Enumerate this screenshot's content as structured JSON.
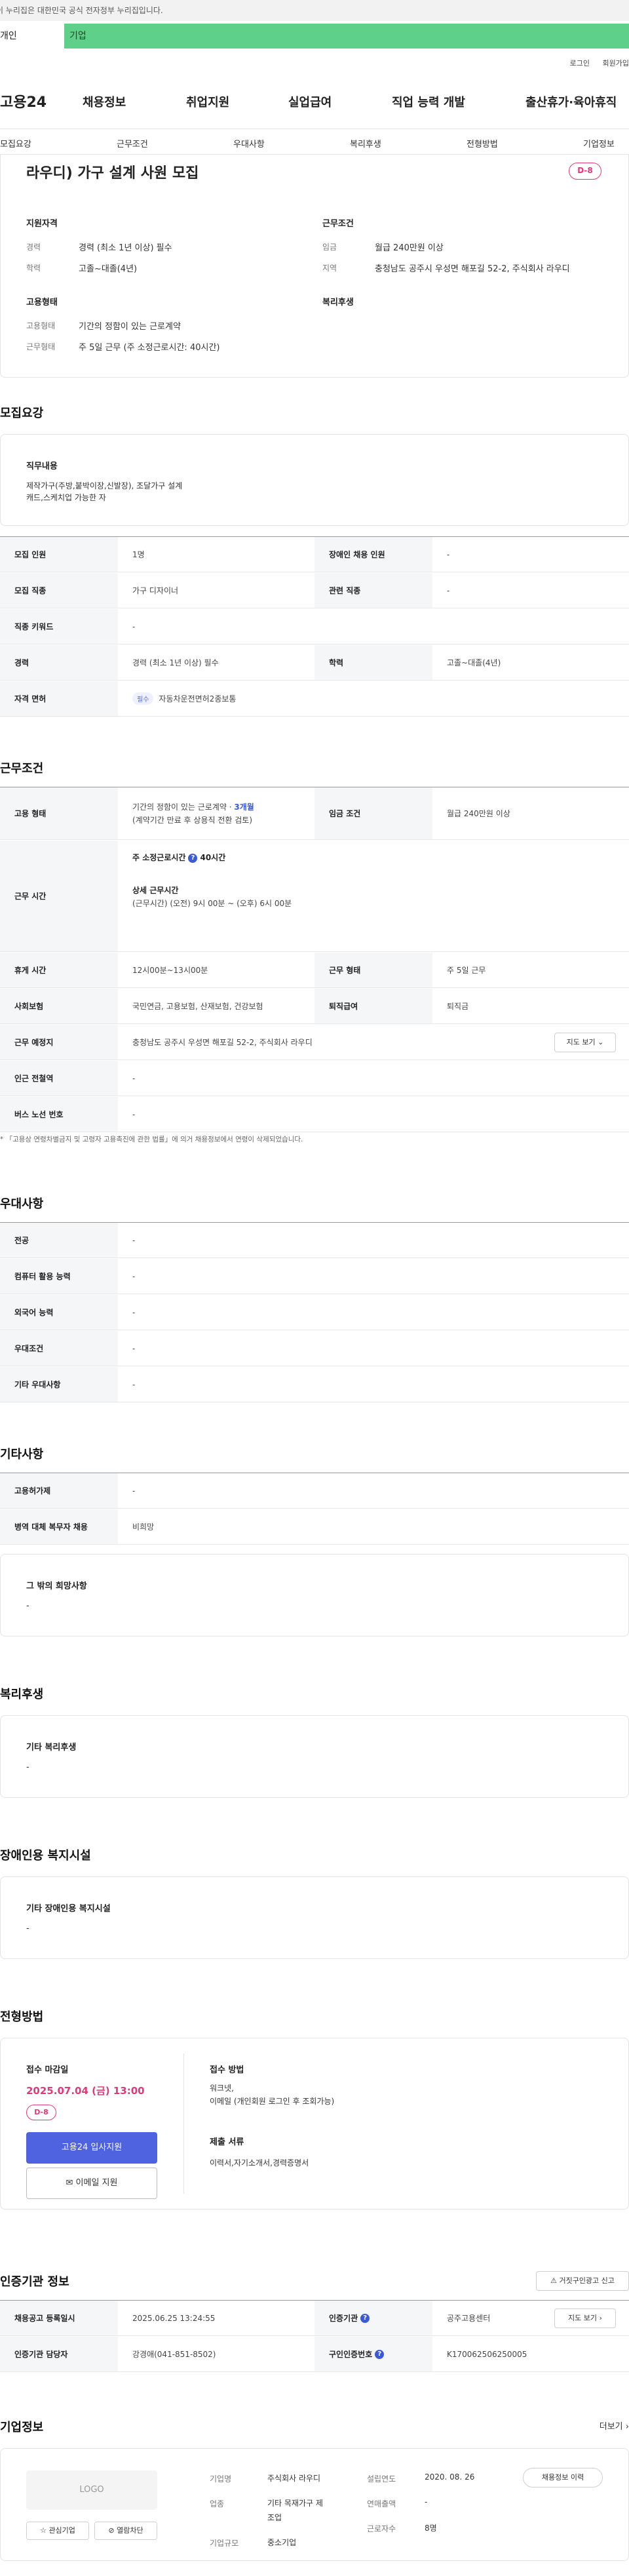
{
  "govbar": {
    "text": "이 누리집은 대한민국 공식 전자정부 누리집입니다."
  },
  "roletabs": [
    "개인",
    "기업"
  ],
  "util": [
    "로그인",
    "회원가입"
  ],
  "gnb": {
    "logo": "고용24",
    "menu": [
      "채용정보",
      "취업지원",
      "실업급여",
      "직업 능력 개발",
      "출산휴가·육아휴직"
    ]
  },
  "subtabs": [
    "모집요강",
    "근무조건",
    "우대사항",
    "복리후생",
    "전형방법",
    "기업정보"
  ],
  "summary": {
    "title": "라우디) 가구 설계 사원 모집",
    "dday": "D-8",
    "qual_h": "지원자격",
    "career_k": "경력",
    "career_v": "경력 (최소 1년 이상) 필수",
    "edu_k": "학력",
    "edu_v": "고졸~대졸(4년)",
    "cond_h": "근무조건",
    "wage_k": "임금",
    "wage_v": "월급 240만원 이상",
    "region_k": "지역",
    "region_v": "충청남도 공주시 우성면 해포길 52-2, 주식회사 라우디",
    "emp_h": "고용형태",
    "emptype_k": "고용형태",
    "emptype_v": "기간의 정함이 있는 근로계약",
    "worktype_k": "근무형태",
    "worktype_v": "주 5일 근무 (주 소정근로시간: 40시간)",
    "welfare_h": "복리후생"
  },
  "recruit": {
    "title": "모집요강",
    "job_h": "직무내용",
    "job_text": [
      "제작가구(주방,붙박이장,신발장), 조달가구 설계",
      "캐드,스케치업 가능한 자"
    ],
    "rows": [
      {
        "k1": "모집 인원",
        "v1": "1명",
        "k2": "장애인 채용 인원",
        "v2": "-"
      },
      {
        "k1": "모집 직종",
        "v1": "가구 디자이너",
        "k2": "관련 직종",
        "v2": "-"
      },
      {
        "k1": "직종 키워드",
        "v1": "-"
      },
      {
        "k1": "경력",
        "v1": "경력 (최소 1년 이상) 필수",
        "k2": "학력",
        "v2": "고졸~대졸(4년)"
      },
      {
        "k1": "자격 면허",
        "v1": "자동차운전면허2종보통",
        "pill": "필수"
      }
    ]
  },
  "work": {
    "title": "근무조건",
    "emp_k": "고용 형태",
    "emp_v1": "기간의 정함이 있는 근로계약 · ",
    "emp_v1b": "3개월",
    "emp_v2": "(계약기간 만료 후 상용직 전환 검토)",
    "wage_k": "임금 조건",
    "wage_v": "월급 240만원 이상",
    "time_k": "근무 시간",
    "time_a1": "주 소정근로시간",
    "time_a2": "40시간",
    "time_b": "상세 근무시간",
    "time_c": "(근무시간) (오전) 9시 00분 ~ (오후) 6시 00분",
    "rest_k": "휴게 시간",
    "rest_v": "12시00분~13시00분",
    "wtype_k": "근무 형태",
    "wtype_v": "주 5일 근무",
    "ins_k": "사회보험",
    "ins_v": "국민연금, 고용보험, 산재보험, 건강보험",
    "sev_k": "퇴직급여",
    "sev_v": "퇴직금",
    "place_k": "근무 예정지",
    "place_v": "충청남도 공주시 우성면 해포길 52-2, 주식회사 라우디",
    "map_btn": "지도 보기",
    "sub_k": "인근 전철역",
    "sub_v": "-",
    "bus_k": "버스 노선 번호",
    "bus_v": "-",
    "note": "* 「고용상 연령차별금지 및 고령자 고용촉진에 관한 법률」에 의거 채용정보에서 연령이 삭제되었습니다."
  },
  "pref": {
    "title": "우대사항",
    "rows": [
      {
        "k": "전공",
        "v": "-"
      },
      {
        "k": "컴퓨터 활용 능력",
        "v": "-"
      },
      {
        "k": "외국어 능력",
        "v": "-"
      },
      {
        "k": "우대조건",
        "v": "-"
      },
      {
        "k": "기타 우대사항",
        "v": "-"
      }
    ]
  },
  "etc": {
    "title": "기타사항",
    "rows": [
      {
        "k": "고용허가제",
        "v": "-"
      },
      {
        "k": "병역 대체 복무자 채용",
        "v": "비희망"
      }
    ],
    "other_h": "그 밖의 희망사항",
    "other_v": "-"
  },
  "welfare": {
    "title": "복리후생",
    "h": "기타 복리후생",
    "v": "-"
  },
  "disabled": {
    "title": "장애인용 복지시설",
    "h": "기타 장애인용 복지시설",
    "v": "-"
  },
  "screening": {
    "title": "전형방법",
    "deadline_h": "접수 마감일",
    "deadline_v": "2025.07.04 (금) 13:00",
    "dday": "D-8",
    "apply_btn": "고용24 입사지원",
    "email_btn": "이메일 지원",
    "method_h": "접수 방법",
    "method_v": [
      "워크넷,",
      "이메일 (개인회원 로그인 후 조회가능)"
    ],
    "doc_h": "제출 서류",
    "doc_v": "이력서,자기소개서,경력증명서"
  },
  "cert": {
    "title": "인증기관 정보",
    "report_btn": "거짓구인광고 신고",
    "r1k1": "채용공고 등록일시",
    "r1v1": "2025.06.25 13:24:55",
    "r1k2": "인증기관",
    "r1v2": "공주고용센터",
    "map_btn": "지도 보기",
    "r2k1": "인증기관 담당자",
    "r2v1": "강경애(041-851-8502)",
    "r2k2": "구인인증번호",
    "r2v2": "K170062506250005"
  },
  "company": {
    "title": "기업정보",
    "more": "더보기",
    "logo": "LOGO",
    "fav_btn": "관심기업",
    "block_btn": "열람차단",
    "name_k": "기업명",
    "name_v": "주식회사 라우디",
    "ind_k": "업종",
    "ind_v": [
      "기타 목재가구 제",
      "조업"
    ],
    "size_k": "기업규모",
    "size_v": "중소기업",
    "est_k": "설립연도",
    "est_v": "2020. 08. 26",
    "sales_k": "연매출액",
    "sales_v": "-",
    "emp_k": "근로자수",
    "emp_v": "8명",
    "hist_btn": "채용정보 이력"
  }
}
